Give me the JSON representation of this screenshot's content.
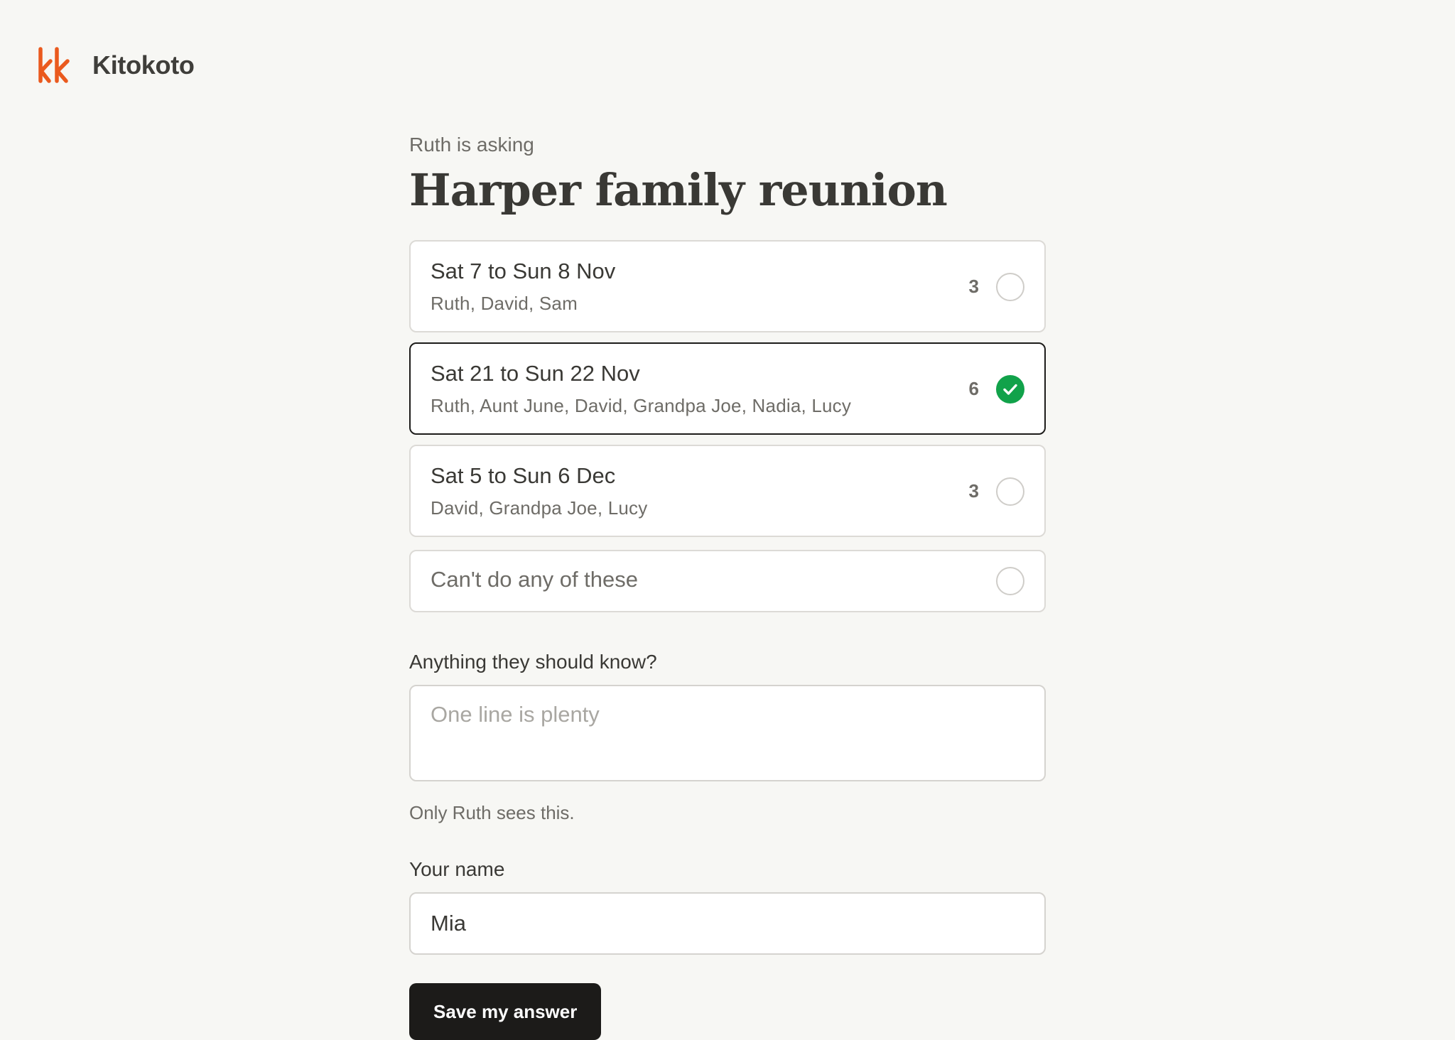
{
  "brand": {
    "logo_icon": "kk-logo-icon",
    "name": "Kitokoto",
    "accent_color": "#ea5a1e"
  },
  "poll": {
    "asker_line": "Ruth is asking",
    "title": "Harper family reunion",
    "options": [
      {
        "date": "Sat 7 to Sun 8 Nov",
        "people": "Ruth, David, Sam",
        "count": "3",
        "selected": false
      },
      {
        "date": "Sat 21 to Sun 22 Nov",
        "people": "Ruth, Aunt June, David, Grandpa Joe, Nadia, Lucy",
        "count": "6",
        "selected": true
      },
      {
        "date": "Sat 5 to Sun 6 Dec",
        "people": "David, Grandpa Joe, Lucy",
        "count": "3",
        "selected": false
      }
    ],
    "none_option": {
      "label": "Can't do any of these",
      "selected": false
    },
    "selected_color": "#11a24a"
  },
  "note": {
    "label": "Anything they should know?",
    "placeholder": "One line is plenty",
    "value": "",
    "hint": "Only Ruth sees this."
  },
  "name_field": {
    "label": "Your name",
    "value": "Mia"
  },
  "submit": {
    "label": "Save my answer"
  }
}
